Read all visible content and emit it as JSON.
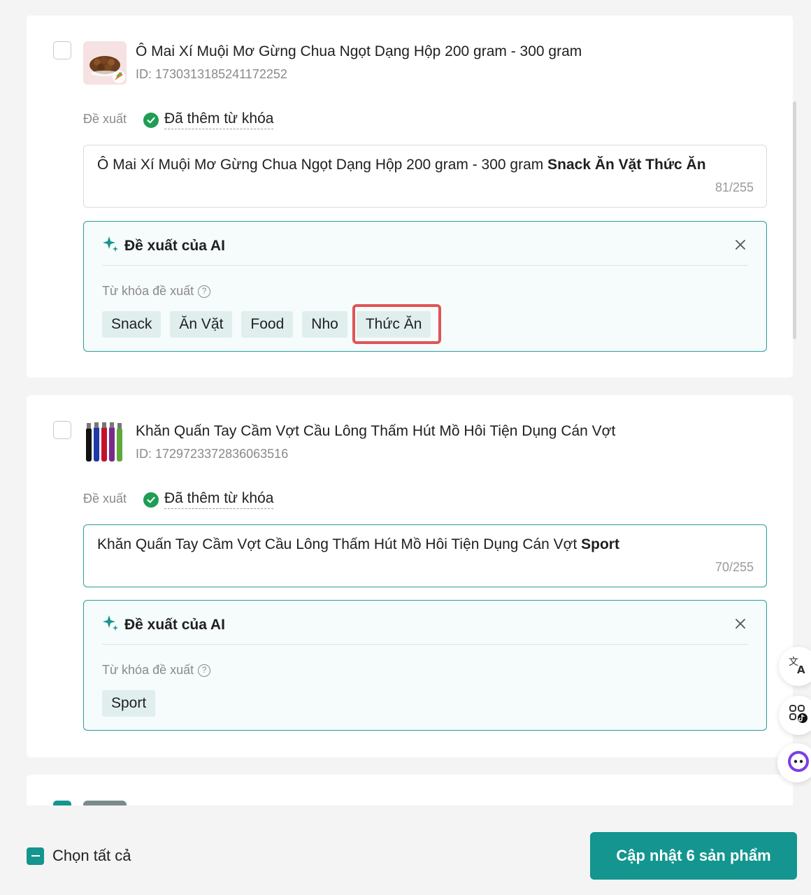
{
  "products": [
    {
      "title": "Ô Mai Xí Muội Mơ Gừng Chua Ngọt Dạng Hộp 200 gram - 300 gram",
      "id": "ID: 1730313185241172252",
      "suggest_label": "Đề xuất",
      "added_label": "Đã thêm từ khóa",
      "title_value": "Ô Mai Xí Muội Mơ Gừng Chua Ngọt Dạng Hộp 200 gram - 300 gram",
      "title_keywords": "Snack Ăn Vặt Thức Ăn",
      "char_count": "81/255",
      "ai_title": "Đề xuất của AI",
      "kw_label": "Từ khóa đề xuất",
      "keywords": [
        "Snack",
        "Ăn Vặt",
        "Food",
        "Nho",
        "Thức Ăn"
      ],
      "highlighted_keyword": "Thức Ăn"
    },
    {
      "title": "Khăn Quấn Tay Cầm Vợt Cầu Lông Thấm Hút Mồ Hôi Tiện Dụng Cán Vợt",
      "id": "ID: 1729723372836063516",
      "suggest_label": "Đề xuất",
      "added_label": "Đã thêm từ khóa",
      "title_value": "Khăn Quấn Tay Cầm Vợt Cầu Lông Thấm Hút Mồ Hôi Tiện Dụng Cán Vợt",
      "title_keywords": "Sport",
      "char_count": "70/255",
      "ai_title": "Đề xuất của AI",
      "kw_label": "Từ khóa đề xuất",
      "keywords": [
        "Sport"
      ]
    }
  ],
  "footer": {
    "select_all_label": "Chọn tất cả",
    "update_button_label": "Cập nhật 6 sản phẩm"
  },
  "colors": {
    "accent": "#14958f",
    "ai_border": "#2a9d9a",
    "chip_bg": "#e0efee",
    "highlight": "#e05555",
    "success": "#1f9d55"
  },
  "icons": [
    "sparkle-icon",
    "close-icon",
    "check-circle-icon",
    "help-icon",
    "translate-icon",
    "apps-icon",
    "assistant-icon"
  ]
}
